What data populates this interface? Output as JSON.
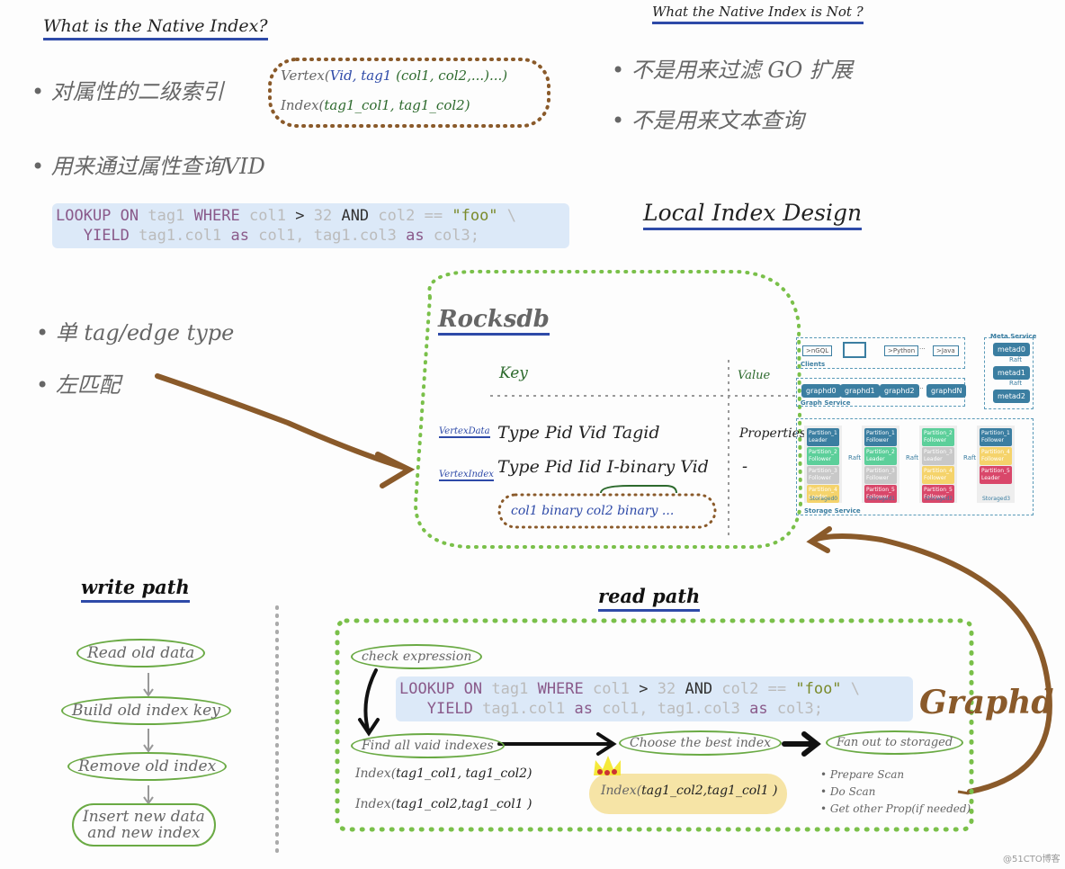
{
  "what_is": {
    "title": "What is the Native Index?",
    "bullets": [
      "对属性的二级索引",
      "用来通过属性查询VID"
    ],
    "note": {
      "line1_prefix": "Vertex(",
      "line1_vid": "Vid, tag1",
      "line1_rest": "(col1, col2,...)...)",
      "line2_prefix": "Index(",
      "line2_args": "tag1_col1, tag1_col2)"
    }
  },
  "query": {
    "kw_lookup": "LOOKUP ON",
    "tag": "tag1",
    "kw_where": "WHERE",
    "col1": "col1",
    "gt": ">",
    "num": "32",
    "and": "AND",
    "col2": "col2",
    "eq": "==",
    "str": "\"foo\"",
    "bs": "\\",
    "kw_yield": "YIELD",
    "y1": "tag1.col1",
    "as": "as",
    "a1": "col1,",
    "y2": "tag1.col3",
    "a2": "col3;"
  },
  "what_not": {
    "title": "What the Native Index is Not ?",
    "bullets": [
      "不是用来过滤 GO 扩展",
      "不是用来文本查询"
    ]
  },
  "local": {
    "title": "Local Index Design",
    "bullets": [
      "单 tag/edge type",
      "左匹配"
    ]
  },
  "rocksdb": {
    "title": "Rocksdb",
    "key": "Key",
    "value": "Value",
    "rows": [
      {
        "label": "VertexData",
        "key": "Type Pid Vid Tagid",
        "value": "Properties"
      },
      {
        "label": "VertexIndex",
        "key": "Type Pid Iid I-binary Vid",
        "value": "-"
      }
    ],
    "binary": "col1 binary   col2 binary  ..."
  },
  "arch": {
    "clients": "Clients",
    "client_items": [
      ">nGQL",
      ">Python",
      "···",
      ">Java"
    ],
    "graph": "Graph Service",
    "graphd": [
      "graphd0",
      "graphd1",
      "graphd2",
      "···",
      "graphdN"
    ],
    "meta": "Meta Service",
    "metad": [
      "metad0",
      "metad1",
      "metad2"
    ],
    "raft": "Raft",
    "storage": "Storage Service",
    "storaged": [
      {
        "name": "Storaged0",
        "parts": [
          [
            "Partition_1",
            "Leader"
          ],
          [
            "Partition_2",
            "Follower"
          ],
          [
            "Partition_3",
            "Follower"
          ],
          [
            "Partition_4",
            "Leader"
          ]
        ]
      },
      {
        "name": "Storaged1",
        "parts": [
          [
            "Partition_1",
            "Follower"
          ],
          [
            "Partition_2",
            "Leader"
          ],
          [
            "Partition_3",
            "Follower"
          ],
          [
            "Partition_5",
            "Follower"
          ]
        ]
      },
      {
        "name": "Storaged2",
        "parts": [
          [
            "Partition_2",
            "Follower"
          ],
          [
            "Partition_3",
            "Leader"
          ],
          [
            "Partition_4",
            "Follower"
          ],
          [
            "Partition_5",
            "Follower"
          ]
        ]
      },
      {
        "name": "Storaged3",
        "parts": [
          [
            "Partition_1",
            "Follower"
          ],
          [
            "Partition_4",
            "Follower"
          ],
          [
            "Partition_5",
            "Leader"
          ]
        ]
      }
    ],
    "colors": {
      "blue": "#3b7ea1",
      "green": "#5ccf9a",
      "gray": "#c8c8c8",
      "yellow": "#f5d36b",
      "red": "#d9476a"
    }
  },
  "write": {
    "title": "write path",
    "steps": [
      "Read old data",
      "Build old index key",
      "Remove old index",
      "Insert new data\nand new index"
    ]
  },
  "read": {
    "title": "read path",
    "check": "check expression",
    "find": "Find all vaid indexes",
    "choose": "Choose the best index",
    "fanout": "Fan out to storaged",
    "idx_prefix": "Index(",
    "idx1": "tag1_col1, tag1_col2)",
    "idx2": "tag1_col2,tag1_col1 )",
    "best": "tag1_col2,tag1_col1 )",
    "fan_items": [
      "Prepare Scan",
      "Do Scan",
      "Get other Prop(if needed)"
    ],
    "graphd": "Graphd"
  },
  "watermark": "@51CTO博客"
}
